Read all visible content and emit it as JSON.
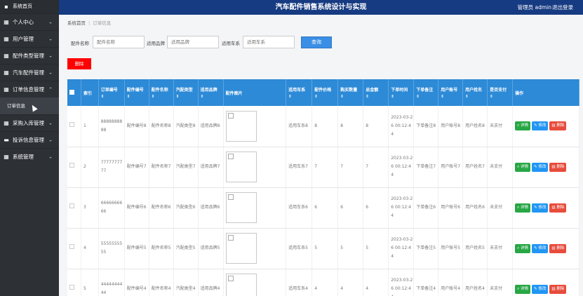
{
  "app": {
    "title": "汽车配件销售系统设计与实现",
    "admin": "管理员 admin",
    "logout": "退出登录"
  },
  "sidebar": {
    "home": "系统首页",
    "items": [
      {
        "label": "个人中心",
        "arrow": "⌄",
        "icon": "grid-icon"
      },
      {
        "label": "用户管理",
        "arrow": "⌄",
        "icon": "grid-icon"
      },
      {
        "label": "配件类型管理",
        "arrow": "⌄",
        "icon": "grid-icon"
      },
      {
        "label": "汽车配件管理",
        "arrow": "⌄",
        "icon": "grid-icon"
      },
      {
        "label": "订单信息管理",
        "arrow": "⌃",
        "icon": "grid-icon"
      },
      {
        "label": "采购入库管理",
        "arrow": "⌄",
        "icon": "grid-icon"
      },
      {
        "label": "投诉信息管理",
        "arrow": "⌄",
        "icon": "chat-icon"
      },
      {
        "label": "系统管理",
        "arrow": "⌄",
        "icon": "grid-icon"
      }
    ],
    "sub_item": "订单信息"
  },
  "breadcrumb": {
    "home": "系统首页",
    "sep": "|",
    "current": "订单信息"
  },
  "search": {
    "fields": [
      {
        "label": "配件名称",
        "placeholder": "配件名称"
      },
      {
        "label": "适用品牌",
        "placeholder": "适用品牌"
      },
      {
        "label": "适用车系",
        "placeholder": "适用车系"
      }
    ],
    "button": "查询"
  },
  "delete_button": "删除",
  "table": {
    "headers": [
      "索引",
      "订单编号",
      "配件编号",
      "配件名称",
      "汽配类型",
      "适用品牌",
      "配件图片",
      "适用车系",
      "配件价格",
      "购买数量",
      "总金额",
      "下单时间",
      "下单备注",
      "用户账号",
      "用户姓名",
      "是否支付",
      "操作"
    ],
    "sort_icon": "⇕",
    "rows": [
      {
        "index": "1",
        "order_no": "8888888888",
        "part_no": "配件编号8",
        "part_name": "配件名称8",
        "type": "汽配类型8",
        "brand": "适用品牌8",
        "series": "适用车系8",
        "price": "8",
        "qty": "8",
        "total": "8",
        "time": "2023-03-26 00:12:44",
        "remark": "下单备注8",
        "account": "用户账号8",
        "name": "用户姓名8",
        "paid": "未支付"
      },
      {
        "index": "2",
        "order_no": "7777777777",
        "part_no": "配件编号7",
        "part_name": "配件名称7",
        "type": "汽配类型7",
        "brand": "适用品牌7",
        "series": "适用车系7",
        "price": "7",
        "qty": "7",
        "total": "7",
        "time": "2023-03-26 00:12:44",
        "remark": "下单备注7",
        "account": "用户账号7",
        "name": "用户姓名7",
        "paid": "未支付"
      },
      {
        "index": "3",
        "order_no": "6666666666",
        "part_no": "配件编号6",
        "part_name": "配件名称6",
        "type": "汽配类型6",
        "brand": "适用品牌6",
        "series": "适用车系6",
        "price": "6",
        "qty": "6",
        "total": "6",
        "time": "2023-03-26 00:12:44",
        "remark": "下单备注6",
        "account": "用户账号6",
        "name": "用户姓名6",
        "paid": "未支付"
      },
      {
        "index": "4",
        "order_no": "5555555555",
        "part_no": "配件编号5",
        "part_name": "配件名称5",
        "type": "汽配类型5",
        "brand": "适用品牌5",
        "series": "适用车系5",
        "price": "5",
        "qty": "5",
        "total": "5",
        "time": "2023-03-26 00:12:44",
        "remark": "下单备注5",
        "account": "用户账号5",
        "name": "用户姓名5",
        "paid": "未支付"
      },
      {
        "index": "5",
        "order_no": "4444444444",
        "part_no": "配件编号4",
        "part_name": "配件名称4",
        "type": "汽配类型4",
        "brand": "适用品牌4",
        "series": "适用车系4",
        "price": "4",
        "qty": "4",
        "total": "4",
        "time": "2023-03-26 00:12:44",
        "remark": "下单备注4",
        "account": "用户账号4",
        "name": "用户姓名4",
        "paid": "未支付"
      }
    ],
    "actions": {
      "detail": "详情",
      "edit": "修改",
      "delete": "删除"
    }
  }
}
